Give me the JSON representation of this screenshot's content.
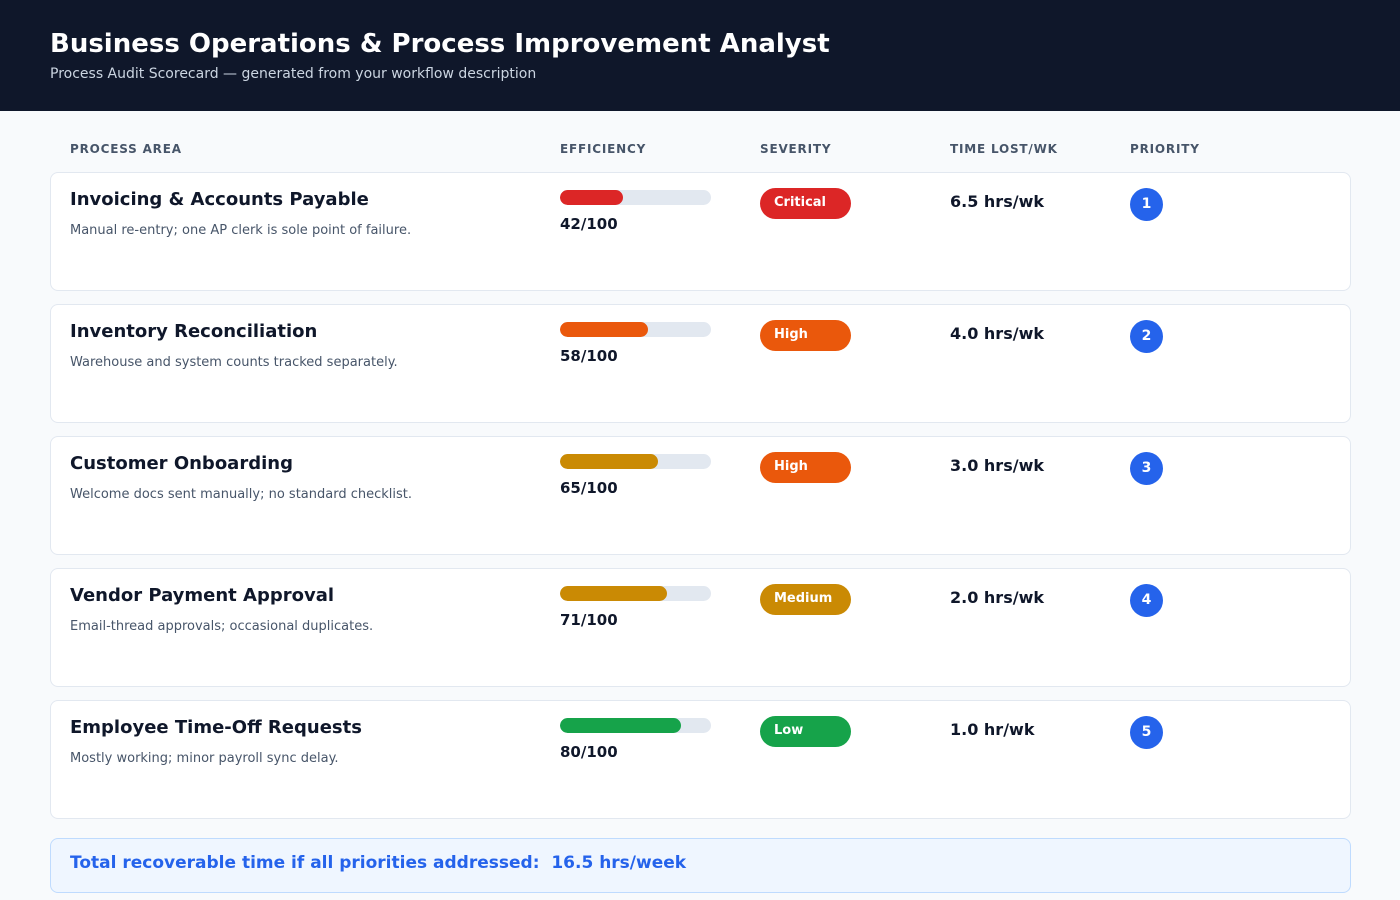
{
  "header": {
    "title": "Business Operations & Process Improvement Analyst",
    "subtitle": "Process Audit Scorecard — generated from your workflow description"
  },
  "columns": {
    "process_area": "PROCESS AREA",
    "efficiency": "EFFICIENCY",
    "severity": "SEVERITY",
    "time_lost": "TIME LOST/WK",
    "priority": "PRIORITY"
  },
  "rows": [
    {
      "name": "Invoicing & Accounts Payable",
      "description": "Manual re-entry; one AP clerk is sole point of failure.",
      "efficiency": 42,
      "efficiency_label": "42/100",
      "bar_color": "#dc2626",
      "severity": "Critical",
      "severity_color": "#dc2626",
      "time_lost": "6.5 hrs/wk",
      "priority": "1"
    },
    {
      "name": "Inventory Reconciliation",
      "description": "Warehouse and system counts tracked separately.",
      "efficiency": 58,
      "efficiency_label": "58/100",
      "bar_color": "#ea580c",
      "severity": "High",
      "severity_color": "#ea580c",
      "time_lost": "4.0 hrs/wk",
      "priority": "2"
    },
    {
      "name": "Customer Onboarding",
      "description": "Welcome docs sent manually; no standard checklist.",
      "efficiency": 65,
      "efficiency_label": "65/100",
      "bar_color": "#ca8a04",
      "severity": "High",
      "severity_color": "#ea580c",
      "time_lost": "3.0 hrs/wk",
      "priority": "3"
    },
    {
      "name": "Vendor Payment Approval",
      "description": "Email-thread approvals; occasional duplicates.",
      "efficiency": 71,
      "efficiency_label": "71/100",
      "bar_color": "#ca8a04",
      "severity": "Medium",
      "severity_color": "#ca8a04",
      "time_lost": "2.0 hrs/wk",
      "priority": "4"
    },
    {
      "name": "Employee Time-Off Requests",
      "description": "Mostly working; minor payroll sync delay.",
      "efficiency": 80,
      "efficiency_label": "80/100",
      "bar_color": "#16a34a",
      "severity": "Low",
      "severity_color": "#16a34a",
      "time_lost": "1.0 hr/wk",
      "priority": "5"
    }
  ],
  "summary": {
    "text": "Total recoverable time if all priorities addressed:  16.5 hrs/week"
  }
}
